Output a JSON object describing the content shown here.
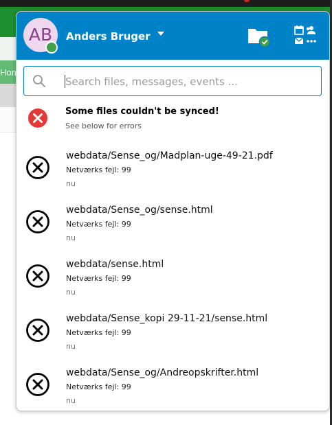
{
  "user": {
    "initials": "AB",
    "name": "Anders Bruger",
    "avatar_color": "#efd7ee",
    "status_color": "#43a047"
  },
  "header": {
    "accent_color": "#0082c9",
    "folder_icon": "folder-sync-ok-icon",
    "apps_icon": "calendar-contacts-mail-more-icon"
  },
  "background": {
    "tab_label": "Hon"
  },
  "search": {
    "placeholder": "Search files, messages, events ...",
    "value": ""
  },
  "alert": {
    "icon": "error-circle-icon",
    "title": "Some files couldn't be synced!",
    "subtitle": "See below for errors"
  },
  "sync_errors": [
    {
      "path": "webdata/Sense_og/Madplan-uge-49-21.pdf",
      "error": "Netværks fejl: 99",
      "time": "nu"
    },
    {
      "path": "webdata/Sense_og/sense.html",
      "error": "Netværks fejl: 99",
      "time": "nu"
    },
    {
      "path": "webdata/sense.html",
      "error": "Netværks fejl: 99",
      "time": "nu"
    },
    {
      "path": "webdata/Sense_kopi 29-11-21/sense.html",
      "error": "Netværks fejl: 99",
      "time": "nu"
    },
    {
      "path": "webdata/Sense_og/Andreopskrifter.html",
      "error": "Netværks fejl: 99",
      "time": "nu"
    }
  ]
}
